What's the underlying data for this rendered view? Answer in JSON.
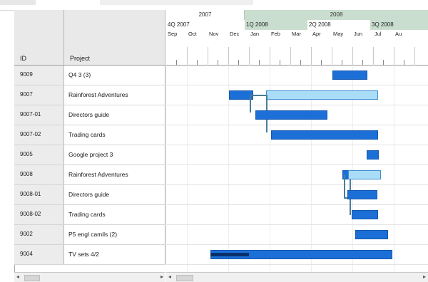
{
  "timeline": {
    "years": [
      "2007",
      "2008"
    ],
    "quarters": [
      "4Q 2007",
      "1Q 2008",
      "2Q 2008",
      "3Q 2008"
    ],
    "months": [
      "Sep",
      "Oct",
      "Nov",
      "Dec",
      "Jan",
      "Feb",
      "Mar",
      "Apr",
      "May",
      "Jun",
      "Jul",
      "Au"
    ]
  },
  "table": {
    "headers": {
      "id": "ID",
      "project": "Project"
    },
    "rows": [
      {
        "id": "9009",
        "project": "Q4 3 (3)"
      },
      {
        "id": "9007",
        "project": "Rainforest Adventures"
      },
      {
        "id": "9007-01",
        "project": "Directors guide"
      },
      {
        "id": "9007-02",
        "project": "Trading cards"
      },
      {
        "id": "9005",
        "project": "Google project 3"
      },
      {
        "id": "9008",
        "project": "Rainforest Adventures"
      },
      {
        "id": "9008-01",
        "project": "Directors guide"
      },
      {
        "id": "9008-02",
        "project": "Trading cards"
      },
      {
        "id": "9002",
        "project": "P5 engl camils (2)"
      },
      {
        "id": "9004",
        "project": "TV sets 4/2"
      }
    ]
  },
  "colors": {
    "bar_dark": "#1c6fd6",
    "bar_light": "#a9dcf7",
    "progress": "#0b2f6b",
    "year_2008_band": "#c9decf"
  }
}
